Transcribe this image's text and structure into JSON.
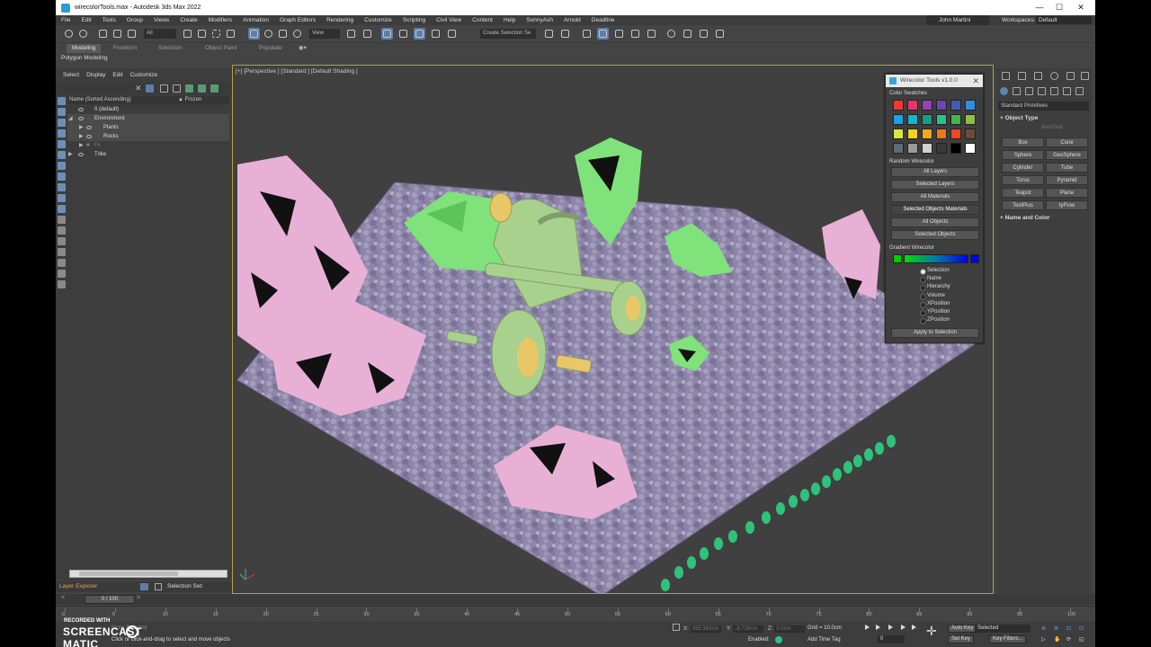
{
  "window": {
    "title": "wirecolorTools.max - Autodesk 3ds Max 2022",
    "controls": [
      "—",
      "☐",
      "✕"
    ]
  },
  "menu": {
    "items": [
      "File",
      "Edit",
      "Tools",
      "Group",
      "Views",
      "Create",
      "Modifiers",
      "Animation",
      "Graph Editors",
      "Rendering",
      "Customize",
      "Scripting",
      "Civil View",
      "Content",
      "Help",
      "SonnyAsh",
      "Arnold",
      "Deadline"
    ],
    "user": "John Martini",
    "workspaces_label": "Workspaces:",
    "workspace_value": "Default"
  },
  "toolbar": {
    "filter_value": "All",
    "view_value": "View",
    "selection_set_placeholder": "Create Selection Se"
  },
  "ribbon": {
    "tabs": [
      "Modeling",
      "Freeform",
      "Selection",
      "Object Paint",
      "Populate"
    ],
    "active_tab": "Modeling",
    "subtitle": "Polygon Modeling"
  },
  "explorer": {
    "menu": [
      "Select",
      "Display",
      "Edit",
      "Customize"
    ],
    "column_name": "Name (Sorted Ascending)",
    "column_frozen": "▲ Frozen",
    "rows": [
      {
        "label": "0 (default)"
      },
      {
        "label": "Environment"
      },
      {
        "label": "Plants"
      },
      {
        "label": "Rocks"
      },
      {
        "label": "Fx"
      },
      {
        "label": "Trike"
      }
    ],
    "layer_explorer_label": "Layer Explorer",
    "selection_set_label": "Selection Set:"
  },
  "viewport": {
    "label": "[+] [Perspective ] [Standard ] [Default Shading ]"
  },
  "wirecolor_tools": {
    "title": "Wirecolor Tools v1.0.0",
    "color_swatches_label": "Color Swatches",
    "swatches": [
      "#f0392b",
      "#e6336e",
      "#9b3fb8",
      "#6a47b8",
      "#3f5bb8",
      "#2e8fe6",
      "#1aa0e6",
      "#17b4cc",
      "#169e8c",
      "#27c28c",
      "#3fb84a",
      "#8bc23f",
      "#d6e63a",
      "#f2d21a",
      "#f2a81a",
      "#f2751a",
      "#f2461a",
      "#6e4a3a",
      "#5a6e78",
      "#9a9a9a",
      "#d0d0d0",
      "#3a3a3a",
      "#000000",
      "#ffffff"
    ],
    "random_label": "Random Wirecolor",
    "random_buttons": [
      "All Layers",
      "Selected Layers",
      "All Materials",
      "Selected Objects Materials",
      "All Objects",
      "Selected Objects"
    ],
    "gradient_label": "Gradient Wirecolor",
    "gradient_options": [
      "Selection",
      "Name",
      "Hierarchy",
      "Volume",
      "XPosition",
      "YPosition",
      "ZPosition"
    ],
    "gradient_selected": "Selection",
    "apply_button": "Apply to Selection"
  },
  "command_panel": {
    "category": "Standard Primitives",
    "object_type_label": "Object Type",
    "autogrid_label": "AutoGrid",
    "primitives": [
      "Box",
      "Cone",
      "Sphere",
      "GeoSphere",
      "Cylinder",
      "Tube",
      "Torus",
      "Pyramid",
      "Teapot",
      "Plane",
      "TextPlus",
      "tyFlow"
    ],
    "name_color_label": "Name and Color"
  },
  "timeline": {
    "frame_display": "0 / 100",
    "ticks": [
      "0",
      "5",
      "10",
      "15",
      "20",
      "25",
      "30",
      "35",
      "40",
      "45",
      "50",
      "55",
      "60",
      "65",
      "70",
      "75",
      "80",
      "85",
      "90",
      "95",
      "100"
    ]
  },
  "status": {
    "selection_info": "None Selected",
    "prompt": "Click or click-and-drag to select and move objects",
    "x_label": "X:",
    "x_value": "155.363cm",
    "y_label": "Y:",
    "y_value": "-8.726cm",
    "z_label": "Z:",
    "z_value": "0.0cm",
    "grid": "Grid = 10.0cm",
    "enabled_label": "Enabled:",
    "add_time_tag": "Add Time Tag",
    "auto_key": "Auto Key",
    "set_key": "Set Key",
    "selected_value": "Selected",
    "key_filters": "Key Filters...",
    "frame_value": "0"
  },
  "watermark": {
    "line1": "RECORDED WITH",
    "line2": "SCREENCAST",
    "line2b": "MATIC"
  },
  "colors": {
    "accent_blue": "#5e7ea8",
    "viewport_border": "#b7a03a",
    "layer_explorer_orange": "#e8a340",
    "plant_pink": "#e9b0d6",
    "plant_green": "#7fe27a",
    "trike_green": "#a9d18e",
    "trike_yellow": "#e8c766",
    "ground_lavender": "#8e86a8",
    "bead_green": "#2fc27a"
  }
}
